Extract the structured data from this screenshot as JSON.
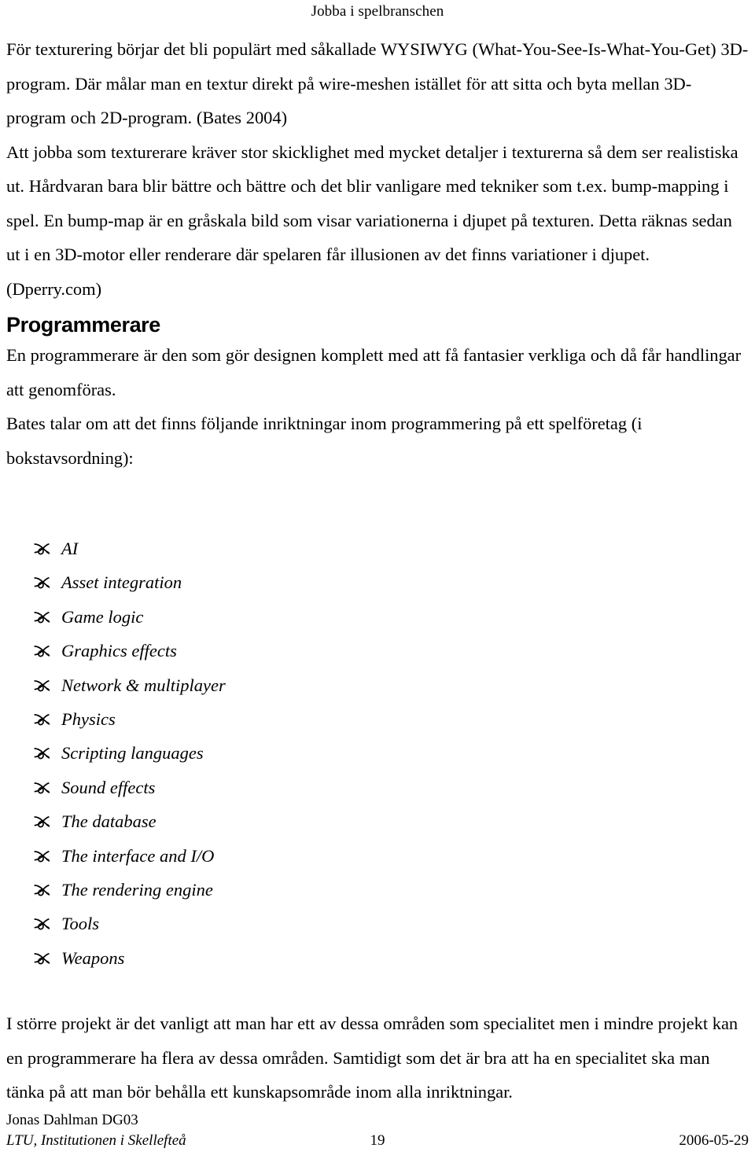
{
  "header": {
    "running_title": "Jobba i spelbranschen"
  },
  "body": {
    "paragraphs": [
      "För texturering börjar det bli populärt med såkallade WYSIWYG (What-You-See-Is-What-You-Get) 3D-program. Där målar man en textur direkt på wire-meshen istället för att sitta och byta mellan 3D-program och 2D-program. (Bates 2004)",
      "Att jobba som texturerare kräver stor skicklighet med mycket detaljer i texturerna så dem ser realistiska ut. Hårdvaran bara blir bättre och bättre och det blir vanligare med tekniker som t.ex. bump-mapping i spel. En bump-map är en gråskala bild som visar variationerna i djupet på texturen. Detta räknas sedan ut i en 3D-motor eller renderare där spelaren får illusionen av det finns variationer i djupet. (Dperry.com)"
    ],
    "section_heading": "Programmerare",
    "section_paragraphs": [
      "En programmerare är den som gör designen komplett med att få fantasier verkliga och då får handlingar att genomföras.",
      "Bates talar om att det finns följande inriktningar inom programmering på ett spelföretag (i bokstavsordning):"
    ],
    "bullet_icon_name": "aldus-leaf-bullet-icon",
    "bullet_items": [
      "AI",
      "Asset integration",
      "Game logic",
      "Graphics effects",
      "Network & multiplayer",
      "Physics",
      "Scripting languages",
      "Sound effects",
      "The database",
      "The interface and I/O",
      "The rendering engine",
      "Tools",
      "Weapons"
    ],
    "closing_paragraph": "I större projekt är det vanligt att man har ett av dessa områden som specialitet men i mindre projekt kan en programmerare ha flera av dessa områden. Samtidigt som det är bra att ha en specialitet ska man tänka på att man bör behålla ett kunskapsområde inom alla inriktningar."
  },
  "footer": {
    "author": "Jonas Dahlman DG03",
    "institution": "LTU, Institutionen i Skellefteå",
    "page_number": "19",
    "date": "2006-05-29"
  },
  "colors": {
    "text": "#000000",
    "background": "#ffffff"
  }
}
